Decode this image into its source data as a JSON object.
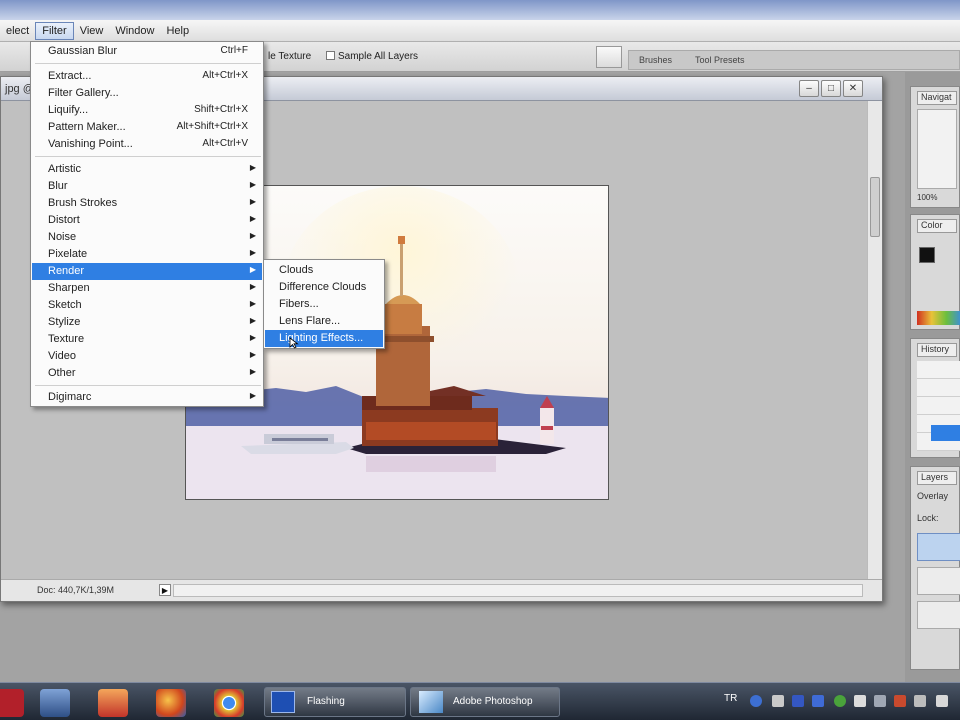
{
  "menubar": {
    "items": [
      "elect",
      "Filter",
      "View",
      "Window",
      "Help"
    ]
  },
  "options_bar": {
    "texture_label": "le Texture",
    "sample_all_layers": "Sample All Layers",
    "well_tabs": [
      "Brushes",
      "Tool Presets"
    ]
  },
  "document": {
    "title": "jpg @",
    "status": "Doc: 440,7K/1,39M"
  },
  "filter_menu": {
    "items": [
      {
        "label": "Gaussian Blur",
        "shortcut": "Ctrl+F"
      },
      {
        "label": "Extract...",
        "shortcut": "Alt+Ctrl+X"
      },
      {
        "label": "Filter Gallery...",
        "shortcut": ""
      },
      {
        "label": "Liquify...",
        "shortcut": "Shift+Ctrl+X"
      },
      {
        "label": "Pattern Maker...",
        "shortcut": "Alt+Shift+Ctrl+X"
      },
      {
        "label": "Vanishing Point...",
        "shortcut": "Alt+Ctrl+V"
      },
      {
        "label": "Artistic",
        "submenu": true
      },
      {
        "label": "Blur",
        "submenu": true
      },
      {
        "label": "Brush Strokes",
        "submenu": true
      },
      {
        "label": "Distort",
        "submenu": true
      },
      {
        "label": "Noise",
        "submenu": true
      },
      {
        "label": "Pixelate",
        "submenu": true
      },
      {
        "label": "Render",
        "submenu": true
      },
      {
        "label": "Sharpen",
        "submenu": true
      },
      {
        "label": "Sketch",
        "submenu": true
      },
      {
        "label": "Stylize",
        "submenu": true
      },
      {
        "label": "Texture",
        "submenu": true
      },
      {
        "label": "Video",
        "submenu": true
      },
      {
        "label": "Other",
        "submenu": true
      },
      {
        "label": "Digimarc",
        "submenu": true
      }
    ]
  },
  "render_submenu": {
    "items": [
      "Clouds",
      "Difference Clouds",
      "Fibers...",
      "Lens Flare...",
      "Lighting Effects..."
    ]
  },
  "panels": {
    "navigator_tab": "Navigat",
    "zoom": "100%",
    "color_tab": "Color",
    "history_tab": "History",
    "layers_tab": "Layers",
    "blend_mode": "Overlay",
    "lock_label": "Lock:"
  },
  "taskbar": {
    "buttons": [
      "Flashing",
      "Adobe Photoshop"
    ],
    "lang": "TR"
  },
  "colors": {
    "highlight": "#2f7fe3",
    "taskbar": "#2a3340"
  }
}
